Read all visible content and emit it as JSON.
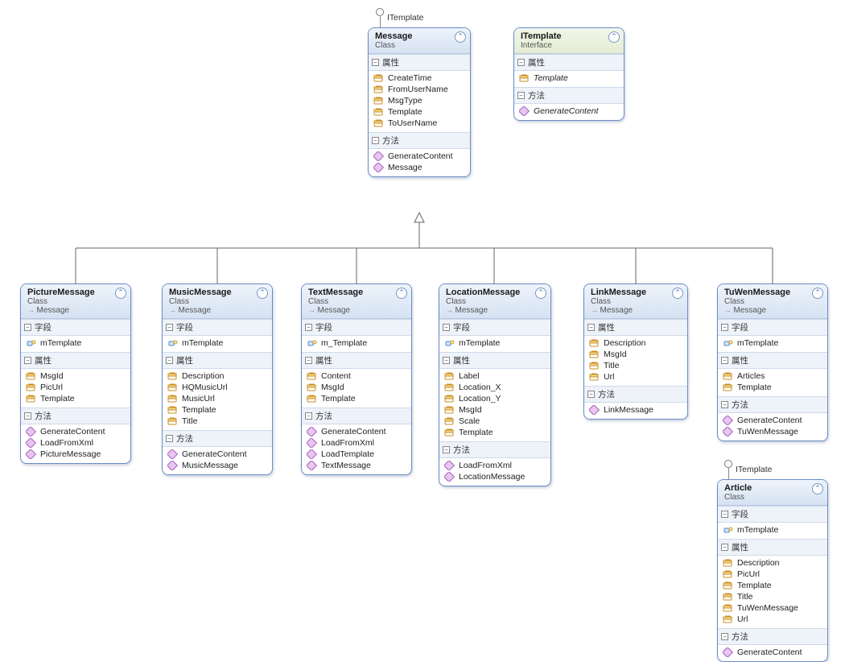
{
  "labels": {
    "section_fields": "字段",
    "section_props": "属性",
    "section_methods": "方法",
    "class_stereo": "Class",
    "interface_stereo": "Interface",
    "iface_name": "ITemplate"
  },
  "boxes": {
    "message": {
      "name": "Message",
      "props": [
        "CreateTime",
        "FromUserName",
        "MsgType",
        "Template",
        "ToUserName"
      ],
      "methods": [
        "GenerateContent",
        "Message"
      ]
    },
    "itemplate": {
      "name": "ITemplate",
      "props": [
        "Template"
      ],
      "methods": [
        "GenerateContent"
      ]
    },
    "picture": {
      "name": "PictureMessage",
      "inherit": "Message",
      "fields": [
        "mTemplate"
      ],
      "props": [
        "MsgId",
        "PicUrl",
        "Template"
      ],
      "methods": [
        "GenerateContent",
        "LoadFromXml",
        "PictureMessage"
      ]
    },
    "music": {
      "name": "MusicMessage",
      "inherit": "Message",
      "fields": [
        "mTemplate"
      ],
      "props": [
        "Description",
        "HQMusicUrl",
        "MusicUrl",
        "Template",
        "Title"
      ],
      "methods": [
        "GenerateContent",
        "MusicMessage"
      ]
    },
    "text": {
      "name": "TextMessage",
      "inherit": "Message",
      "fields": [
        "m_Template"
      ],
      "props": [
        "Content",
        "MsgId",
        "Template"
      ],
      "methods": [
        "GenerateContent",
        "LoadFromXml",
        "LoadTemplate",
        "TextMessage"
      ]
    },
    "location": {
      "name": "LocationMessage",
      "inherit": "Message",
      "fields": [
        "mTemplate"
      ],
      "props": [
        "Label",
        "Location_X",
        "Location_Y",
        "MsgId",
        "Scale",
        "Template"
      ],
      "methods": [
        "LoadFromXml",
        "LocationMessage"
      ]
    },
    "link": {
      "name": "LinkMessage",
      "inherit": "Message",
      "props": [
        "Description",
        "MsgId",
        "Title",
        "Url"
      ],
      "methods": [
        "LinkMessage"
      ]
    },
    "tuwen": {
      "name": "TuWenMessage",
      "inherit": "Message",
      "fields": [
        "mTemplate"
      ],
      "props": [
        "Articles",
        "Template"
      ],
      "methods": [
        "GenerateContent",
        "TuWenMessage"
      ]
    },
    "article": {
      "name": "Article",
      "fields": [
        "mTemplate"
      ],
      "props": [
        "Description",
        "PicUrl",
        "Template",
        "Title",
        "TuWenMessage",
        "Url"
      ],
      "methods": [
        "GenerateContent"
      ]
    }
  }
}
